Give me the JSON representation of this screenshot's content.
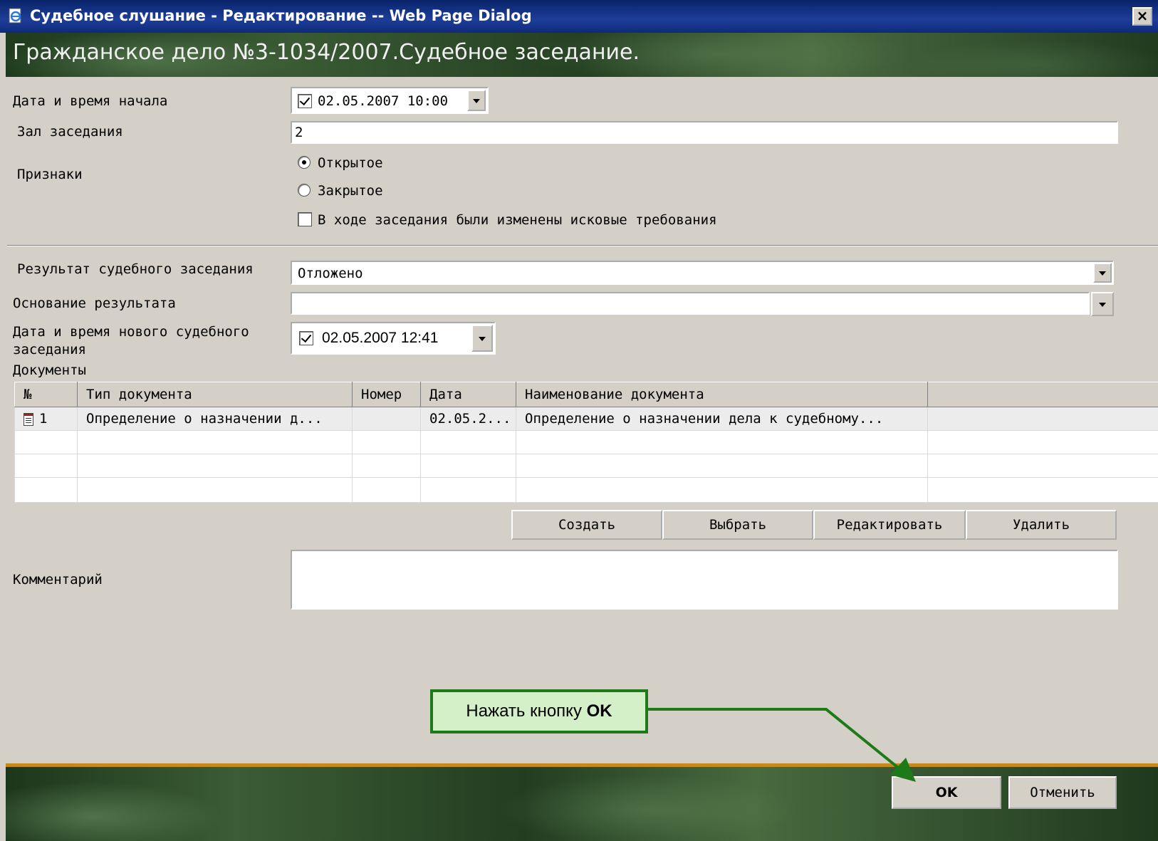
{
  "window": {
    "title": "Судебное слушание - Редактирование -- Web Page Dialog",
    "close_label": "×"
  },
  "header": {
    "title": "Гражданское дело №3-1034/2007.Судебное заседание."
  },
  "form": {
    "start_label": "Дата и время начала",
    "start_value": "02.05.2007 10:00",
    "start_checked": true,
    "hall_label": "Зал заседания",
    "hall_value": "2",
    "signs_label": "Признаки",
    "radio_open": "Открытое",
    "radio_closed": "Закрытое",
    "radio_selected": "Открытое",
    "claims_changed_label": "В ходе заседания были изменены исковые требования",
    "claims_changed_checked": false,
    "result_label": "Результат судебного заседания",
    "result_value": "Отложено",
    "basis_label": "Основание результата",
    "basis_value": "",
    "new_date_label_line1": "Дата и время нового судебного",
    "new_date_label_line2": "заседания",
    "new_date_value": "02.05.2007 12:41",
    "new_date_checked": true,
    "comment_label": "Комментарий",
    "comment_value": ""
  },
  "documents": {
    "label": "Документы",
    "columns": [
      "№",
      "Тип документа",
      "Номер",
      "Дата",
      "Наименование документа",
      ""
    ],
    "rows": [
      {
        "num": "1",
        "type": "Определение о назначении д...",
        "number": "",
        "date": "02.05.2...",
        "name": "Определение о назначении дела к судебному...",
        "extra": "",
        "icon": "document-icon"
      }
    ],
    "buttons": {
      "create": "Создать",
      "select": "Выбрать",
      "edit": "Редактировать",
      "delete": "Удалить"
    }
  },
  "footer": {
    "ok_label": "OK",
    "cancel_label": "Отменить"
  },
  "callout": {
    "text_prefix": "Нажать кнопку ",
    "text_bold": "OK",
    "color": "#1e7a18"
  },
  "colors": {
    "titlebar": "#0a246a",
    "dialog_bg": "#d4d0c8",
    "footer_accent": "#c68a1a",
    "callout_bg": "#d4f0c8"
  }
}
